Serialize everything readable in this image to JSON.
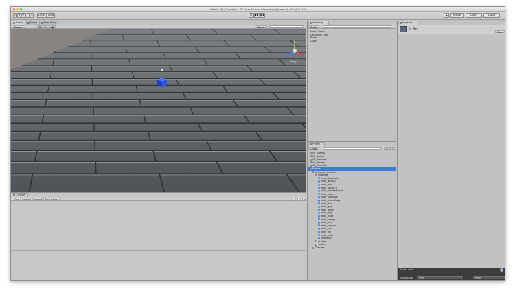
{
  "window": {
    "title": "Untitled - 04_Transform - PC, Mac & Linux Standalone (Personal) <OpenGL 4.1>"
  },
  "toolbar": {
    "pivot_label": "Center",
    "space_label": "Local",
    "collab_label": "",
    "account_label": "Account",
    "layers_label": "Layers",
    "layout_label": "Layout"
  },
  "scene": {
    "tabs": [
      "Scene",
      "Game",
      "Asset Store"
    ],
    "shading": "Shaded",
    "mode_2d": "2D",
    "gizmos_label": "Gizmos",
    "persp_label": "Persp"
  },
  "hierarchy": {
    "tab": "Hierarchy",
    "create_label": "Create",
    "items": [
      "Main Camera",
      "Directional Light",
      "Plane",
      "Cube"
    ]
  },
  "project": {
    "tab": "Project",
    "create_label": "Create",
    "items": [
      {
        "label": "01_Scenes",
        "type": "folder",
        "level": 0
      },
      {
        "label": "02_Scripts",
        "type": "folder",
        "level": 0
      },
      {
        "label": "03_Materials",
        "type": "folder",
        "level": 0
      },
      {
        "label": "04_Prefabs",
        "type": "folder",
        "level": 0
      },
      {
        "label": "05_Controllers",
        "type": "folder",
        "level": 0
      },
      {
        "label": "Plugins",
        "type": "folder",
        "level": 0,
        "selected": true
      },
      {
        "label": "prototype_textures",
        "type": "folder",
        "level": 1
      },
      {
        "label": "Materials",
        "type": "folder",
        "level": 2
      },
      {
        "label": "mesh_baseworld",
        "type": "mat",
        "level": 3
      },
      {
        "label": "proto_alpha_d",
        "type": "mat",
        "level": 3
      },
      {
        "label": "proto_blue",
        "type": "mat",
        "level": 3
      },
      {
        "label": "proto_bricks_d",
        "type": "mat",
        "level": 3
      },
      {
        "label": "proto_checkerboard",
        "type": "mat",
        "level": 3
      },
      {
        "label": "proto_circle",
        "type": "mat",
        "level": 3
      },
      {
        "label": "proto_crosshair",
        "type": "mat",
        "level": 3
      },
      {
        "label": "proto_camouflage",
        "type": "mat",
        "level": 3
      },
      {
        "label": "proto_floor",
        "type": "mat",
        "level": 3
      },
      {
        "label": "proto_gray",
        "type": "mat",
        "level": 3
      },
      {
        "label": "proto_green",
        "type": "mat",
        "level": 3
      },
      {
        "label": "proto_map",
        "type": "mat",
        "level": 3
      },
      {
        "label": "proto_node",
        "type": "mat",
        "level": 3
      },
      {
        "label": "proto_orange",
        "type": "mat",
        "level": 3
      },
      {
        "label": "proto_pipe",
        "type": "mat",
        "level": 3
      },
      {
        "label": "proto_rainbow",
        "type": "mat",
        "level": 3
      },
      {
        "label": "proto_red",
        "type": "mat",
        "level": 3
      },
      {
        "label": "proto_rim",
        "type": "mat",
        "level": 3
      },
      {
        "label": "proto_wave",
        "type": "mat",
        "level": 3
      },
      {
        "label": "composer",
        "type": "mat",
        "level": 3
      },
      {
        "label": "readme",
        "type": "file",
        "level": 2
      },
      {
        "label": "readme",
        "type": "file",
        "level": 2
      },
      {
        "label": "Textures",
        "type": "folder",
        "level": 1
      }
    ]
  },
  "console": {
    "tab": "Console",
    "buttons": [
      "Clear",
      "Collapse",
      "Clear on Play",
      "Error Pause"
    ]
  },
  "inspector": {
    "tab": "Inspector",
    "object_name": "04_Rez",
    "open_label": "Open",
    "asset_labels_title": "Asset Labels",
    "assetbundle_label": "AssetBundle",
    "assetbundle_value": "None",
    "variant_value": "None"
  },
  "colors": {
    "chrome": "#c2c2c2",
    "selection": "#3d7bd6",
    "floor": "#5d6368",
    "sky": "#8a8480"
  }
}
